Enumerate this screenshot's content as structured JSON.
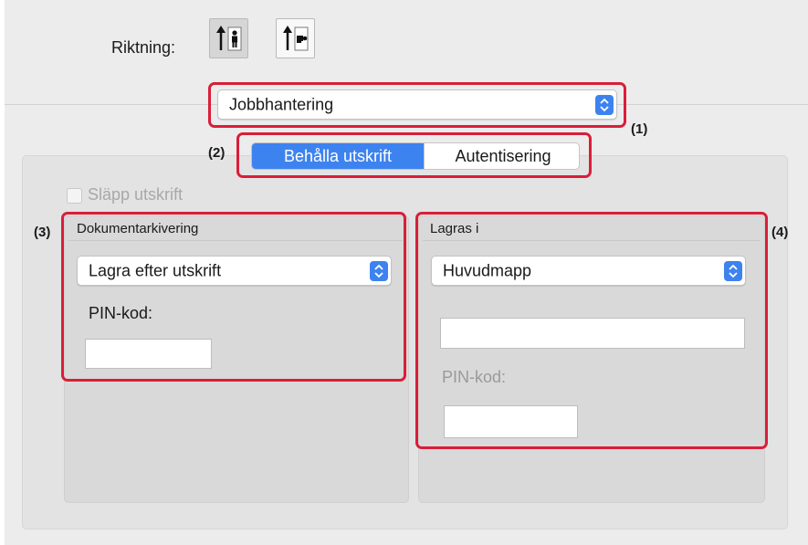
{
  "orientation": {
    "label": "Riktning:",
    "options": [
      {
        "icon": "portrait-orientation-icon",
        "selected": true
      },
      {
        "icon": "landscape-orientation-icon",
        "selected": false
      }
    ]
  },
  "panel_popup": {
    "value": "Jobbhantering"
  },
  "tabs": {
    "left": "Behålla utskrift",
    "right": "Autentisering",
    "selected": "Behålla utskrift"
  },
  "release_print": {
    "label": "Släpp utskrift",
    "checked": false,
    "enabled": false
  },
  "document_filing": {
    "title": "Dokumentarkivering",
    "mode_value": "Lagra efter utskrift",
    "pin_label": "PIN-kod:",
    "pin_value": ""
  },
  "store_in": {
    "title": "Lagras i",
    "folder_value": "Huvudmapp",
    "name_value": "",
    "pin_label": "PIN-kod:",
    "pin_value": "",
    "pin_enabled": false
  },
  "callouts": {
    "c1": "(1)",
    "c2": "(2)",
    "c3": "(3)",
    "c4": "(4)"
  },
  "colors": {
    "accent": "#3d83f0",
    "callout_box": "#d91e39",
    "window_bg": "#ececec"
  }
}
